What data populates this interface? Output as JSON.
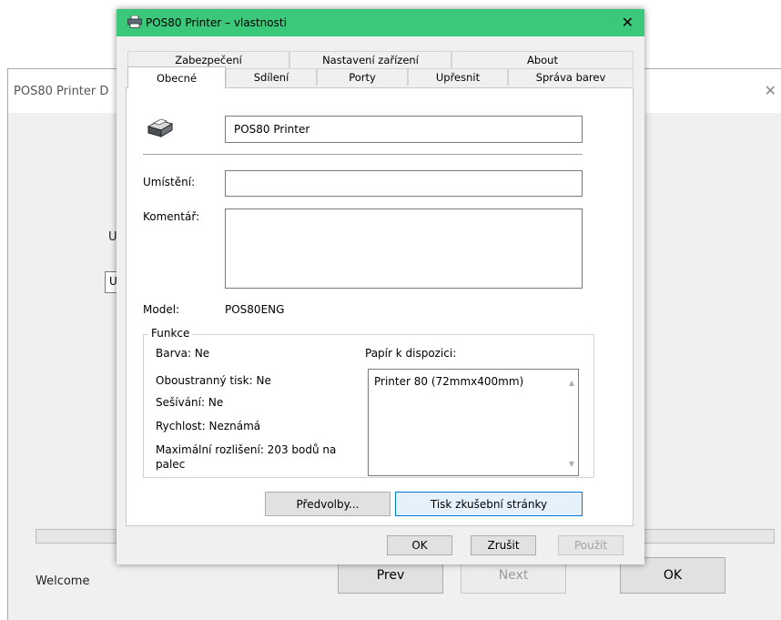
{
  "background_window": {
    "title": "POS80 Printer D",
    "label_fragment": "Us",
    "input_fragment": "U",
    "status": "Welcome",
    "prev_label": "Prev",
    "next_label": "Next",
    "ok_label": "OK"
  },
  "dialog": {
    "title": "POS80 Printer – vlastnosti",
    "tabs_row1": [
      "Zabezpečení",
      "Nastavení zařízení",
      "About"
    ],
    "tabs_row2": [
      "Obecné",
      "Sdílení",
      "Porty",
      "Upřesnit",
      "Správa barev"
    ],
    "active_tab": "Obecné",
    "printer_name": "POS80 Printer",
    "location_label": "Umístění:",
    "location_value": "",
    "comment_label": "Komentář:",
    "comment_value": "",
    "model_label": "Model:",
    "model_value": "POS80ENG",
    "features": {
      "group_title": "Funkce",
      "color": "Barva: Ne",
      "duplex": "Oboustranný tisk: Ne",
      "staple": "Sešívání: Ne",
      "speed": "Rychlost: Neznámá",
      "resolution_line1": "Maximální rozlišení: 203 bodů na",
      "resolution_line2": "palec",
      "paper_label": "Papír k dispozici:",
      "paper_items": [
        "Printer 80 (72mmx400mm)"
      ]
    },
    "preferences_label": "Předvolby...",
    "test_page_label": "Tisk zkušební stránky",
    "ok_label": "OK",
    "cancel_label": "Zrušit",
    "apply_label": "Použít"
  },
  "colors": {
    "titlebar": "#3cc87a",
    "focus_border": "#0078d7",
    "dialog_bg": "#f0f0f0"
  }
}
